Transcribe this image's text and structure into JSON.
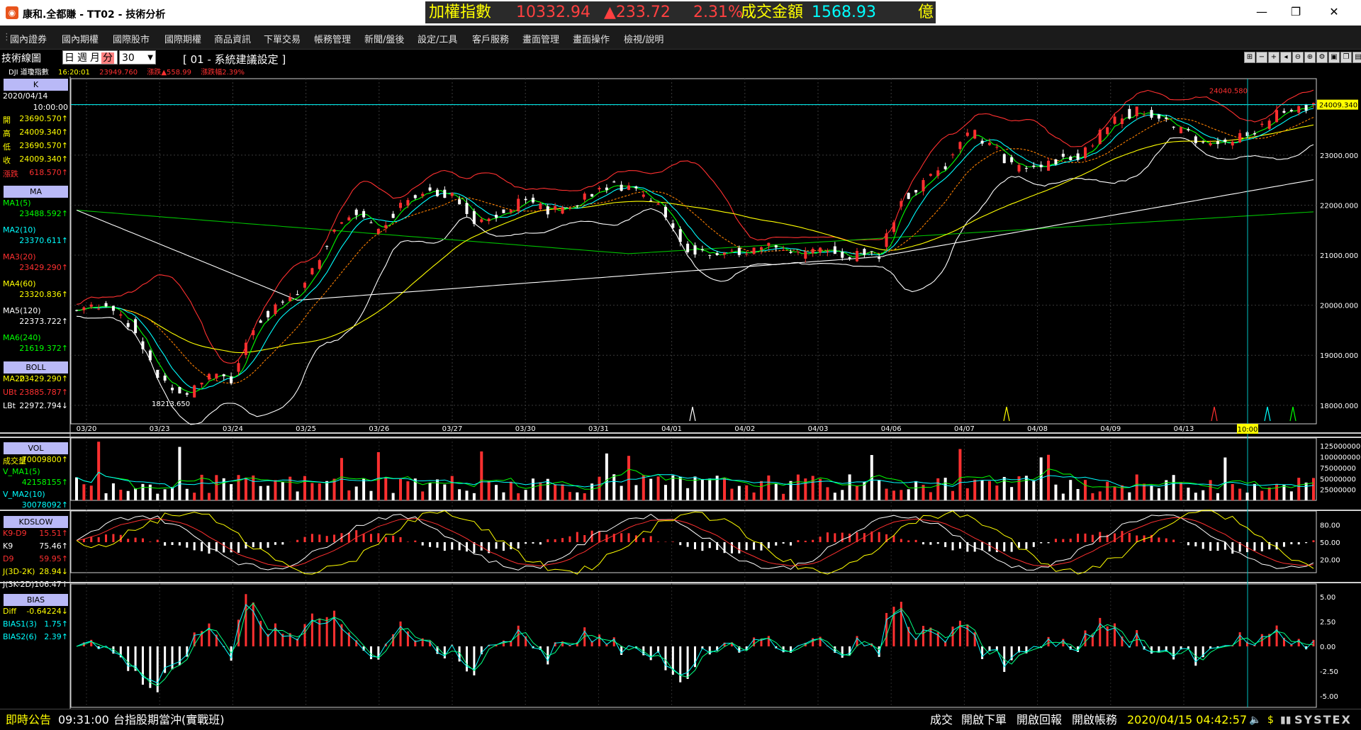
{
  "window": {
    "title": "康和.全都賺 - TT02 - 技術分析",
    "minimize": "—",
    "maximize": "❐",
    "close": "✕"
  },
  "ticker": {
    "name": "加權指數",
    "value": "10332.94",
    "change": "▲233.72",
    "change_pct": "2.31%",
    "turnover_label": "成交金額",
    "turnover": "1568.93",
    "unit": "億"
  },
  "menu": [
    "國內證券",
    "國內期權",
    "國際股市",
    "國際期權",
    "商品資訊",
    "下單交易",
    "帳務管理",
    "新聞/盤後",
    "設定/工具",
    "客戶服務",
    "畫面管理",
    "畫面操作",
    "檢視/說明"
  ],
  "toolbar": {
    "panel_name": "技術線圖",
    "periods": [
      "日",
      "週",
      "月",
      "分"
    ],
    "selected_period": "分",
    "interval": "30",
    "setting": "[ 01 - 系統建議設定 ]",
    "dji": {
      "name": "DJI 道瓊指數",
      "time": "16:20:01",
      "price": "23949.760",
      "change": "漲跌▲558.99",
      "change_pct": "漲跌幅2.39%"
    },
    "icons": [
      "window-split-icon",
      "zoom-out-icon",
      "zoom-in-icon",
      "left-icon",
      "search-minus-icon",
      "search-plus-icon",
      "settings-icon",
      "save-icon",
      "copy-icon",
      "print-icon"
    ]
  },
  "sidebar": {
    "k": {
      "head": "K",
      "date": "2020/04/14",
      "time": "10:00:00",
      "rows": [
        {
          "label": "開",
          "value": "23690.570↑",
          "color": "#ffff00"
        },
        {
          "label": "高",
          "value": "24009.340↑",
          "color": "#ffff00"
        },
        {
          "label": "低",
          "value": "23690.570↑",
          "color": "#ffff00"
        },
        {
          "label": "收",
          "value": "24009.340↑",
          "color": "#ffff00"
        },
        {
          "label": "漲跌",
          "value": "618.570↑",
          "color": "#ff3030"
        }
      ]
    },
    "ma": {
      "head": "MA",
      "rows": [
        {
          "label": "MA1(5)",
          "value": "23488.592↑",
          "color": "#00ff00"
        },
        {
          "label": "MA2(10)",
          "value": "23370.611↑",
          "color": "#00ffff"
        },
        {
          "label": "MA3(20)",
          "value": "23429.290↑",
          "color": "#ff3030"
        },
        {
          "label": "MA4(60)",
          "value": "23320.836↑",
          "color": "#ffff00"
        },
        {
          "label": "MA5(120)",
          "value": "22373.722↑",
          "color": "#ffffff"
        },
        {
          "label": "MA6(240)",
          "value": "21619.372↑",
          "color": "#00ff00"
        }
      ]
    },
    "boll": {
      "head": "BOLL",
      "rows": [
        {
          "label": "MA20",
          "value": "23429.290↑",
          "color": "#ffff00"
        },
        {
          "label": "UBt",
          "value": "23885.787↑",
          "color": "#ff3030"
        },
        {
          "label": "LBt",
          "value": "22972.794↓",
          "color": "#ffffff"
        }
      ]
    },
    "vol": {
      "head": "VOL",
      "rows": [
        {
          "label": "成交量",
          "value": "70009800↑",
          "color": "#ffff00"
        },
        {
          "label": "V_MA1(5)",
          "value": "42158155↑",
          "color": "#00ff00"
        },
        {
          "label": "V_MA2(10)",
          "value": "30078092↑",
          "color": "#00ffff"
        }
      ]
    },
    "kd": {
      "head": "KDSLOW",
      "rows": [
        {
          "label": "K9-D9",
          "value": "15.51↑",
          "color": "#ff3030"
        },
        {
          "label": "K9",
          "value": "75.46↑",
          "color": "#ffffff"
        },
        {
          "label": "D9",
          "value": "59.95↑",
          "color": "#ff3030"
        },
        {
          "label": "J(3D-2K)",
          "value": "28.94↓",
          "color": "#ffff00"
        },
        {
          "label": "J(3K-2D)",
          "value": "106.47↑",
          "color": "#ffffff"
        }
      ]
    },
    "bias": {
      "head": "BIAS",
      "rows": [
        {
          "label": "Diff",
          "value": "-0.64224↓",
          "color": "#ffff00"
        },
        {
          "label": "BIAS1(3)",
          "value": "1.75↑",
          "color": "#00ffff"
        },
        {
          "label": "BIAS2(6)",
          "value": "2.39↑",
          "color": "#00ffff"
        }
      ]
    }
  },
  "chart_data": {
    "type": "candlestick",
    "x_labels": [
      "03/20",
      "03/23",
      "03/24",
      "03/25",
      "03/26",
      "03/27",
      "03/30",
      "03/31",
      "04/01",
      "04/02",
      "04/03",
      "04/06",
      "04/07",
      "04/08",
      "04/09",
      "04/13"
    ],
    "cursor_label": "10:00",
    "ylim": [
      17700,
      24500
    ],
    "y_ticks": [
      "24000.000",
      "23000.000",
      "22000.000",
      "21000.000",
      "20000.000",
      "19000.000",
      "18000.000"
    ],
    "price_label": "24009.340",
    "high_label": "24040.580",
    "low_label": "18213.650",
    "vol_ticks": [
      "125000000",
      "100000000",
      "75000000",
      "50000000",
      "25000000"
    ],
    "kd_ticks": [
      "80.00",
      "50.00",
      "20.00"
    ],
    "bias_ticks": [
      "5.00",
      "2.50",
      "0.00",
      "-2.50",
      "-5.00"
    ],
    "close_path": [
      [
        0,
        19900
      ],
      [
        8,
        20050
      ],
      [
        15,
        19600
      ],
      [
        22,
        18600
      ],
      [
        30,
        18213
      ],
      [
        38,
        18700
      ],
      [
        42,
        18450
      ],
      [
        48,
        19600
      ],
      [
        55,
        20000
      ],
      [
        62,
        20400
      ],
      [
        70,
        21500
      ],
      [
        76,
        21900
      ],
      [
        82,
        21500
      ],
      [
        90,
        22200
      ],
      [
        96,
        22300
      ],
      [
        102,
        22200
      ],
      [
        108,
        21700
      ],
      [
        115,
        21850
      ],
      [
        122,
        22100
      ],
      [
        128,
        21850
      ],
      [
        135,
        22050
      ],
      [
        142,
        22300
      ],
      [
        150,
        22400
      ],
      [
        158,
        22000
      ],
      [
        165,
        21200
      ],
      [
        172,
        20950
      ],
      [
        180,
        21050
      ],
      [
        188,
        21200
      ],
      [
        196,
        21000
      ],
      [
        205,
        21100
      ],
      [
        212,
        21000
      ],
      [
        218,
        21000
      ],
      [
        224,
        22100
      ],
      [
        230,
        22400
      ],
      [
        236,
        22800
      ],
      [
        242,
        23500
      ],
      [
        248,
        23200
      ],
      [
        254,
        22800
      ],
      [
        260,
        22700
      ],
      [
        266,
        22900
      ],
      [
        272,
        23000
      ],
      [
        278,
        23400
      ],
      [
        284,
        23800
      ],
      [
        290,
        23900
      ],
      [
        296,
        23650
      ],
      [
        302,
        23400
      ],
      [
        308,
        23200
      ],
      [
        314,
        23300
      ],
      [
        320,
        23450
      ],
      [
        326,
        23800
      ],
      [
        330,
        23950
      ],
      [
        336,
        24009
      ]
    ]
  },
  "statusbar": {
    "news_label": "即時公告",
    "news_time": "09:31:00",
    "news_text": "台指股期當沖(實戰班)",
    "btn_trade": "成交",
    "btn_order": "開啟下單",
    "btn_report": "開啟回報",
    "btn_account": "開啟帳務",
    "datetime": "2020/04/15 04:42:57",
    "brand": "SYSTEX"
  }
}
